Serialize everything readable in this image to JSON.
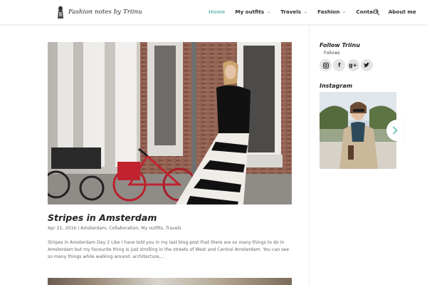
{
  "header": {
    "logo_text": "Fashion notes by Triinu",
    "nav": [
      {
        "label": "Home",
        "active": true,
        "dropdown": false
      },
      {
        "label": "My outfits",
        "active": false,
        "dropdown": true
      },
      {
        "label": "Travels",
        "active": false,
        "dropdown": true
      },
      {
        "label": "Fashion",
        "active": false,
        "dropdown": true
      },
      {
        "label": "Contact",
        "active": false,
        "dropdown": false
      },
      {
        "label": "About me",
        "active": false,
        "dropdown": false
      }
    ],
    "search_icon": "search-icon"
  },
  "post": {
    "title": "Stripes in Amsterdam",
    "date": "Apr 21, 2016",
    "separator": "|",
    "categories": [
      "Amsterdam",
      "Collaboration",
      "My outfits",
      "Travels"
    ],
    "excerpt": "Stripes in Amsterdam Day 2 Like I have told you in my last blog post that there are so many things to do in Amsterdam but my favourite thing is just strolling in the streets of West and Central Amsterdam. You can see so many things while walking around: architecture,..."
  },
  "sidebar": {
    "follow_title": "Follow Triinu",
    "follows_label": "Follows",
    "social": [
      {
        "icon": "instagram-icon",
        "glyph": "◙"
      },
      {
        "icon": "facebook-icon",
        "glyph": "f"
      },
      {
        "icon": "google-plus-icon",
        "glyph": "g+"
      },
      {
        "icon": "twitter-icon",
        "glyph": "🐦"
      }
    ],
    "instagram_title": "Instagram",
    "carousel_next_icon": "chevron-right-icon"
  },
  "colors": {
    "accent": "#7fbfb8",
    "title": "#222222",
    "text": "#666666",
    "social_bg": "#e3e3e3"
  }
}
